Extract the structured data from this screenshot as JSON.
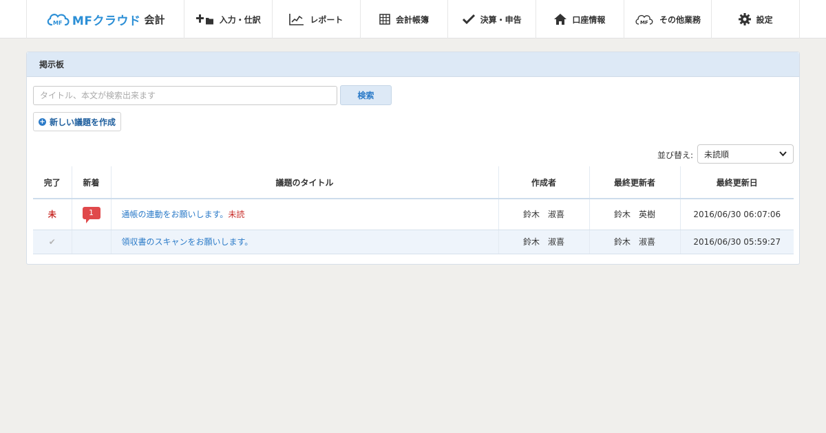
{
  "header": {
    "logo_brand": "MFクラウド",
    "logo_sub": "会計",
    "nav": [
      {
        "label": "入力・仕訳",
        "icon": "plus-folder-icon"
      },
      {
        "label": "レポート",
        "icon": "line-chart-icon"
      },
      {
        "label": "会計帳簿",
        "icon": "ledger-grid-icon"
      },
      {
        "label": "決算・申告",
        "icon": "checkmark-icon"
      },
      {
        "label": "口座情報",
        "icon": "home-icon"
      },
      {
        "label": "その他業務",
        "icon": "cloud-mf-icon"
      },
      {
        "label": "設定",
        "icon": "gear-icon"
      }
    ]
  },
  "board": {
    "title": "掲示板",
    "search": {
      "placeholder": "タイトル、本文が検索出来ます",
      "value": "",
      "button": "検索"
    },
    "new_topic_label": "新しい議題を作成",
    "sort": {
      "label": "並び替え:",
      "selected": "未読順"
    },
    "columns": [
      "完了",
      "新着",
      "議題のタイトル",
      "作成者",
      "最終更新者",
      "最終更新日"
    ],
    "rows": [
      {
        "done": "未",
        "new_count": "1",
        "title": "通帳の連動をお願いします。",
        "unread_tag": "未読",
        "creator": "鈴木　淑喜",
        "updater": "鈴木　英樹",
        "updated_at": "2016/06/30 06:07:06"
      },
      {
        "done": "✔",
        "new_count": "",
        "title": "領収書のスキャンをお願いします。",
        "unread_tag": "",
        "creator": "鈴木　淑喜",
        "updater": "鈴木　淑喜",
        "updated_at": "2016/06/30 05:59:27"
      }
    ]
  },
  "colors": {
    "brand": "#2c8fd6",
    "link": "#2c7bc8",
    "alert": "#e0494b",
    "panel_head": "#dde9f6"
  }
}
